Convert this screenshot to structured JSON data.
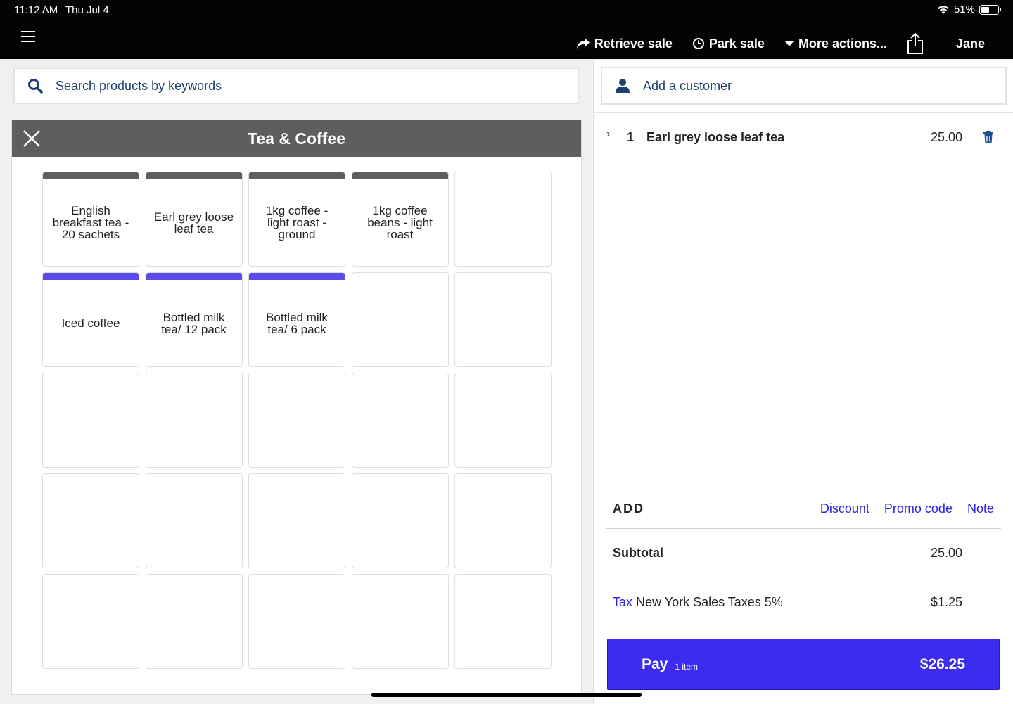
{
  "status_bar": {
    "time": "11:12 AM",
    "date": "Thu Jul 4",
    "battery_percent": "51%",
    "battery_level": 0.51
  },
  "top_bar": {
    "actions": [
      {
        "label": "Retrieve sale",
        "icon": "share-arrow-icon"
      },
      {
        "label": "Park sale",
        "icon": "clock-icon"
      },
      {
        "label": "More actions...",
        "icon": "caret-down-icon"
      }
    ],
    "user_name": "Jane"
  },
  "search": {
    "placeholder": "Search products by keywords",
    "value": ""
  },
  "category": {
    "title": "Tea & Coffee",
    "tiles": [
      {
        "label": "English breakfast tea - 20 sachets",
        "color": "#5e5e5e"
      },
      {
        "label": "Earl grey loose leaf tea",
        "color": "#5e5e5e"
      },
      {
        "label": "1kg coffee - light roast - ground",
        "color": "#5e5e5e"
      },
      {
        "label": "1kg coffee beans - light roast",
        "color": "#5e5e5e"
      },
      {
        "label": "",
        "color": ""
      },
      {
        "label": "Iced coffee",
        "color": "#5b4be8"
      },
      {
        "label": "Bottled milk tea/ 12 pack",
        "color": "#5b4be8"
      },
      {
        "label": "Bottled milk tea/ 6 pack",
        "color": "#5b4be8"
      },
      {
        "label": "",
        "color": ""
      },
      {
        "label": "",
        "color": ""
      },
      {
        "label": "",
        "color": ""
      },
      {
        "label": "",
        "color": ""
      },
      {
        "label": "",
        "color": ""
      },
      {
        "label": "",
        "color": ""
      },
      {
        "label": "",
        "color": ""
      },
      {
        "label": "",
        "color": ""
      },
      {
        "label": "",
        "color": ""
      },
      {
        "label": "",
        "color": ""
      },
      {
        "label": "",
        "color": ""
      },
      {
        "label": "",
        "color": ""
      },
      {
        "label": "",
        "color": ""
      },
      {
        "label": "",
        "color": ""
      },
      {
        "label": "",
        "color": ""
      },
      {
        "label": "",
        "color": ""
      },
      {
        "label": "",
        "color": ""
      }
    ]
  },
  "sale": {
    "customer_placeholder": "Add a customer",
    "line_items": [
      {
        "qty": "1",
        "name": "Earl grey loose leaf tea",
        "price": "25.00"
      }
    ],
    "add_label": "ADD",
    "add_links": [
      "Discount",
      "Promo code",
      "Note"
    ],
    "subtotal_label": "Subtotal",
    "subtotal_value": "25.00",
    "tax_word": "Tax",
    "tax_name": "New York Sales Taxes 5%",
    "tax_value": "$1.25",
    "pay_label": "Pay",
    "pay_count": "1 item",
    "pay_total": "$26.25"
  },
  "colors": {
    "accent": "#3b2cf0",
    "link": "#2b22e3",
    "header": "#5e5e5e"
  }
}
